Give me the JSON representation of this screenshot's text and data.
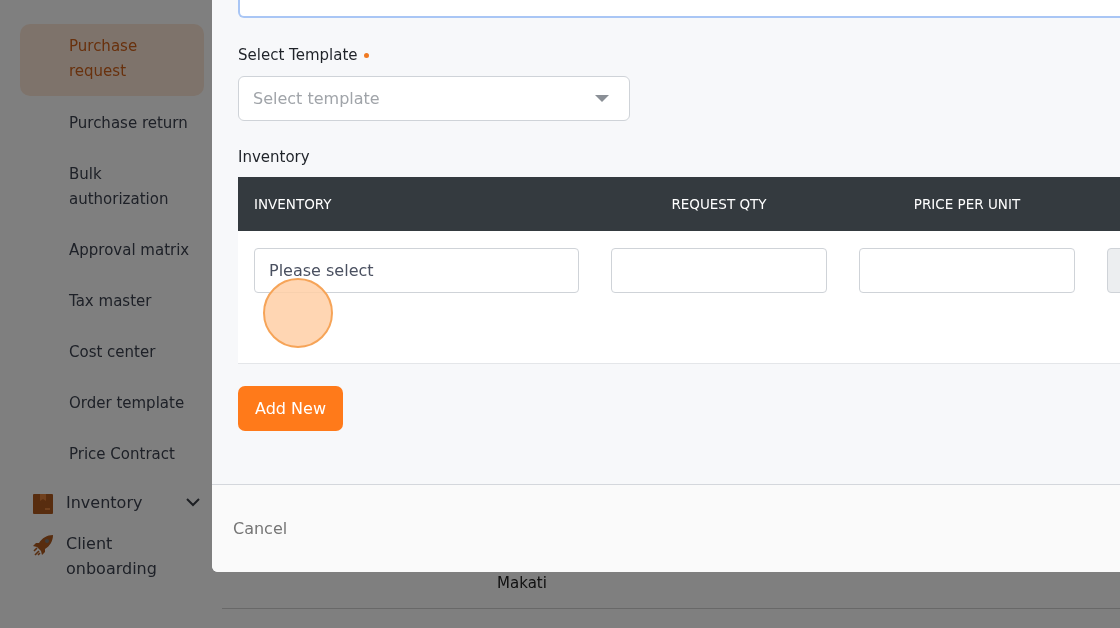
{
  "sidebar": {
    "items": [
      {
        "label": "Purchase request",
        "kind": "sub",
        "selected": true
      },
      {
        "label": "Purchase return",
        "kind": "sub",
        "selected": false
      },
      {
        "label": "Bulk authorization",
        "kind": "sub",
        "selected": false
      },
      {
        "label": "Approval matrix",
        "kind": "sub",
        "selected": false
      },
      {
        "label": "Tax master",
        "kind": "sub",
        "selected": false
      },
      {
        "label": "Cost center",
        "kind": "sub",
        "selected": false
      },
      {
        "label": "Order template",
        "kind": "sub",
        "selected": false
      },
      {
        "label": "Price Contract",
        "kind": "sub",
        "selected": false
      },
      {
        "label": "Inventory",
        "kind": "box",
        "selected": false,
        "expandable": true
      },
      {
        "label": "Client onboarding",
        "kind": "rocket",
        "selected": false,
        "expandable": false
      }
    ]
  },
  "background": {
    "cell": "Makati"
  },
  "modal": {
    "template": {
      "label": "Select Template",
      "required": true,
      "placeholder": "Select template"
    },
    "inventory": {
      "label": "Inventory",
      "columns": [
        "INVENTORY",
        "REQUEST QTY",
        "PRICE PER UNIT"
      ],
      "rows": [
        {
          "fields": [
            {
              "kind": "text",
              "placeholder": "Please select"
            },
            {
              "kind": "text"
            },
            {
              "kind": "text"
            },
            {
              "kind": "disabled"
            }
          ]
        }
      ]
    },
    "add_button": "Add New",
    "cancel_button": "Cancel"
  }
}
